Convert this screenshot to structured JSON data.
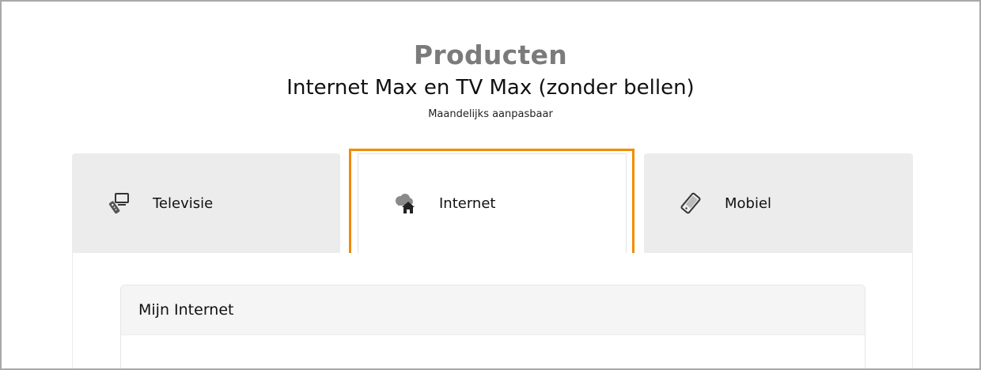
{
  "header": {
    "title": "Producten",
    "product_name": "Internet Max en TV Max (zonder bellen)",
    "subtitle": "Maandelijks aanpasbaar"
  },
  "tabs": [
    {
      "label": "Televisie",
      "icon": "remote-control-icon",
      "selected": false
    },
    {
      "label": "Internet",
      "icon": "cloud-house-icon",
      "selected": true
    },
    {
      "label": "Mobiel",
      "icon": "mobile-phone-icon",
      "selected": false
    }
  ],
  "card": {
    "title": "Mijn Internet"
  },
  "colors": {
    "highlight": "#f08c00",
    "title_grey": "#7b7b7b",
    "tab_inactive_bg": "#ececec"
  }
}
